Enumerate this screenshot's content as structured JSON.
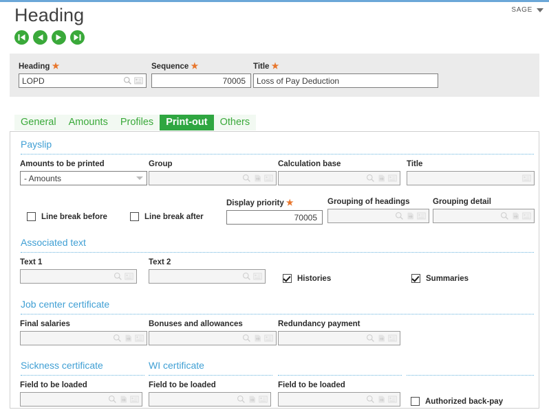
{
  "window": {
    "title": "Heading",
    "brand": "SAGE",
    "brand_caret": "chevron-down-icon"
  },
  "nav": {
    "first": "first-record",
    "previous": "previous-record",
    "next": "next-record",
    "last": "last-record"
  },
  "header_fields": [
    {
      "label": "Heading",
      "required": "★",
      "value": "LOPD",
      "align": "left",
      "icons": [
        "search-icon",
        "list-icon"
      ],
      "readonly": false
    },
    {
      "label": "Sequence",
      "required": "★",
      "value": "70005",
      "align": "right",
      "icons": [],
      "readonly": false
    },
    {
      "label": "Title",
      "required": "★",
      "value": "Loss of Pay Deduction",
      "align": "left",
      "icons": [],
      "readonly": false
    }
  ],
  "tabs": [
    {
      "label": "General",
      "active": false
    },
    {
      "label": "Amounts",
      "active": false
    },
    {
      "label": "Profiles",
      "active": false
    },
    {
      "label": "Print-out",
      "active": true
    },
    {
      "label": "Others",
      "active": false
    }
  ],
  "sections": {
    "payslip": {
      "title": "Payslip",
      "fields": {
        "amounts_to_be_printed": {
          "label": "Amounts to be printed",
          "value": "- Amounts"
        },
        "group": {
          "label": "Group",
          "value": ""
        },
        "calculation_base": {
          "label": "Calculation base",
          "value": ""
        },
        "title": {
          "label": "Title",
          "value": ""
        },
        "display_priority": {
          "label": "Display priority",
          "required": "★",
          "value": "70005"
        },
        "grouping_of_headings": {
          "label": "Grouping of headings",
          "value": ""
        },
        "grouping_detail": {
          "label": "Grouping detail",
          "value": ""
        }
      },
      "checkboxes": {
        "line_break_before": {
          "label": "Line break before",
          "checked": false
        },
        "line_break_after": {
          "label": "Line break after",
          "checked": false
        }
      }
    },
    "associated_text": {
      "title": "Associated text",
      "fields": {
        "text1": {
          "label": "Text 1",
          "value": ""
        },
        "text2": {
          "label": "Text 2",
          "value": ""
        }
      },
      "checkboxes": {
        "histories": {
          "label": "Histories",
          "checked": true
        },
        "summaries": {
          "label": "Summaries",
          "checked": true
        }
      }
    },
    "job_center_certificate": {
      "title": "Job center certificate",
      "fields": {
        "final_salaries": {
          "label": "Final salaries",
          "value": ""
        },
        "bonuses_and_allowances": {
          "label": "Bonuses and allowances",
          "value": ""
        },
        "redundancy_payment": {
          "label": "Redundancy payment",
          "value": ""
        }
      }
    },
    "sickness_certificate": {
      "title": "Sickness certificate",
      "fields": {
        "field_to_be_loaded": {
          "label": "Field to be loaded",
          "value": ""
        }
      }
    },
    "wi_certificate": {
      "title": "WI certificate",
      "fields": {
        "field_to_be_loaded": {
          "label": "Field to be loaded",
          "value": ""
        }
      }
    },
    "third_block": {
      "fields": {
        "field_to_be_loaded": {
          "label": "Field to be loaded",
          "value": ""
        }
      },
      "checkboxes": {
        "authorized_back_pay": {
          "label": "Authorized back-pay",
          "checked": false
        }
      }
    }
  },
  "colors": {
    "accent_green": "#2fa641",
    "section_blue": "#3f9fd4",
    "required_orange": "#e8762c",
    "top_border_blue": "#6ba7d8",
    "header_strip": "#ebebeb"
  }
}
